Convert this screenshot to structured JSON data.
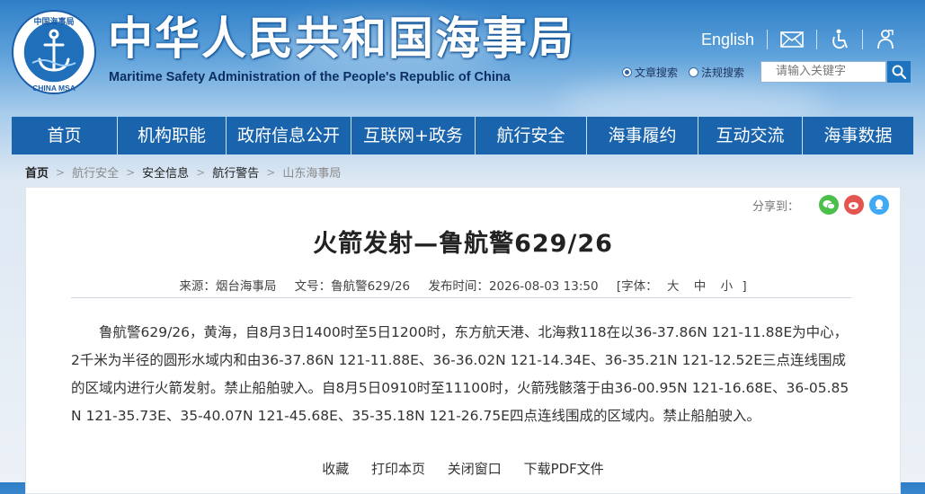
{
  "header": {
    "title_cn": "中华人民共和国海事局",
    "title_en": "Maritime Safety Administration of the People's Republic of China",
    "logo": {
      "top_text": "中国海事局",
      "bottom_text": "CHINA MSA",
      "icon": "anchor-emblem-icon"
    }
  },
  "utility": {
    "english_label": "English",
    "icons": [
      "mail-icon",
      "accessibility-icon",
      "elderly-mode-icon"
    ]
  },
  "search": {
    "options": [
      {
        "label": "文章搜索",
        "selected": true
      },
      {
        "label": "法规搜索",
        "selected": false
      }
    ],
    "placeholder": "请输入关键字",
    "button_icon": "search-icon"
  },
  "nav": {
    "items": [
      "首页",
      "机构职能",
      "政府信息公开",
      "互联网+政务",
      "航行安全",
      "海事履约",
      "互动交流",
      "海事数据"
    ]
  },
  "breadcrumb": [
    "首页",
    "航行安全",
    "安全信息",
    "航行警告",
    "山东海事局"
  ],
  "article": {
    "share_label": "分享到：",
    "share_icons": [
      "wechat-icon",
      "weibo-icon",
      "qq-icon"
    ],
    "title": "火箭发射—鲁航警629/26",
    "source_label": "来源：",
    "source": "烟台海事局",
    "doc_no_label": "文号：",
    "doc_no": "鲁航警629/26",
    "time_label": "发布时间：",
    "time": "2026-08-03 13:50",
    "font_label": "[字体：",
    "font_large": "大",
    "font_medium": "中",
    "font_small": "小",
    "font_close": "]",
    "body": "鲁航警629/26，黄海，自8月3日1400时至5日1200时，东方航天港、北海救118在以36-37.86N 121-11.88E为中心，2千米为半径的圆形水域内和由36-37.86N 121-11.88E、36-36.02N 121-14.34E、36-35.21N 121-12.52E三点连线围成的区域内进行火箭发射。禁止船舶驶入。自8月5日0910时至11100时，火箭残骸落于由36-00.95N 121-16.68E、36-05.85N 121-35.73E、35-40.07N 121-45.68E、35-35.18N 121-26.75E四点连线围成的区域内。禁止船舶驶入。",
    "actions": [
      "收藏",
      "打印本页",
      "关闭窗口",
      "下载PDF文件"
    ]
  },
  "colors": {
    "nav_bg": "#1a64ad",
    "search_button": "#1e73be",
    "title_en": "#0d2f63",
    "wechat": "#4cbf4a",
    "weibo": "#e5554f",
    "qq": "#3fa9f5"
  }
}
